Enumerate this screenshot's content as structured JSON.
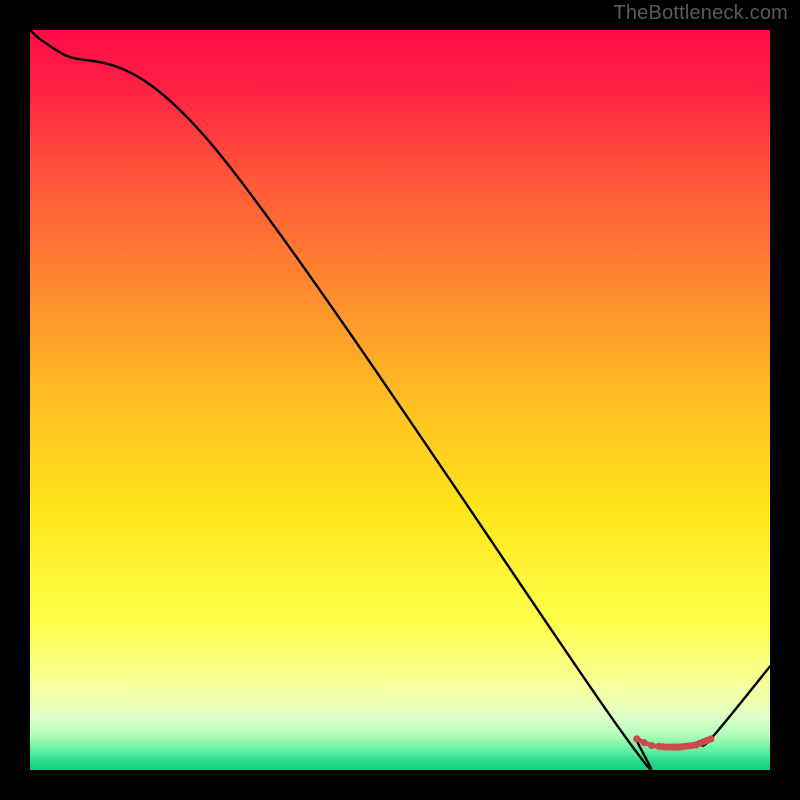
{
  "watermark": "TheBottleneck.com",
  "chart_data": {
    "type": "line",
    "title": "",
    "xlabel": "",
    "ylabel": "",
    "xlim": [
      0,
      100
    ],
    "ylim": [
      0,
      100
    ],
    "grid": false,
    "x": [
      0,
      4,
      25,
      79,
      82,
      84,
      85,
      86,
      87,
      88.5,
      89.5,
      90.5,
      92,
      100
    ],
    "y": [
      100,
      97,
      84,
      6.5,
      4.2,
      3.3,
      3.2,
      3.1,
      3.1,
      3.2,
      3.3,
      3.6,
      4.2,
      14
    ],
    "markers": {
      "x": [
        82,
        83,
        84,
        85,
        85.5,
        86,
        86.5,
        87,
        87.3,
        87.6,
        88,
        88.5,
        89,
        89.5,
        90,
        90.5,
        91,
        91.5,
        92
      ],
      "y": [
        4.2,
        3.7,
        3.3,
        3.2,
        3.15,
        3.1,
        3.1,
        3.1,
        3.1,
        3.1,
        3.12,
        3.2,
        3.25,
        3.3,
        3.4,
        3.6,
        3.8,
        4.0,
        4.2
      ]
    },
    "gradient_stops": [
      {
        "offset": 0.0,
        "color": "#ff0b46"
      },
      {
        "offset": 0.08,
        "color": "#ff2244"
      },
      {
        "offset": 0.2,
        "color": "#ff563a"
      },
      {
        "offset": 0.35,
        "color": "#ff8a2f"
      },
      {
        "offset": 0.5,
        "color": "#ffbe22"
      },
      {
        "offset": 0.65,
        "color": "#ffe61a"
      },
      {
        "offset": 0.8,
        "color": "#fdff4a"
      },
      {
        "offset": 0.89,
        "color": "#f6ffa0"
      },
      {
        "offset": 0.93,
        "color": "#dcffc8"
      },
      {
        "offset": 0.955,
        "color": "#a9fcb7"
      },
      {
        "offset": 0.975,
        "color": "#5ceea0"
      },
      {
        "offset": 0.99,
        "color": "#24d98a"
      },
      {
        "offset": 1.0,
        "color": "#0fd181"
      }
    ],
    "line_color": "#000000",
    "marker_color": "#d0484c"
  }
}
